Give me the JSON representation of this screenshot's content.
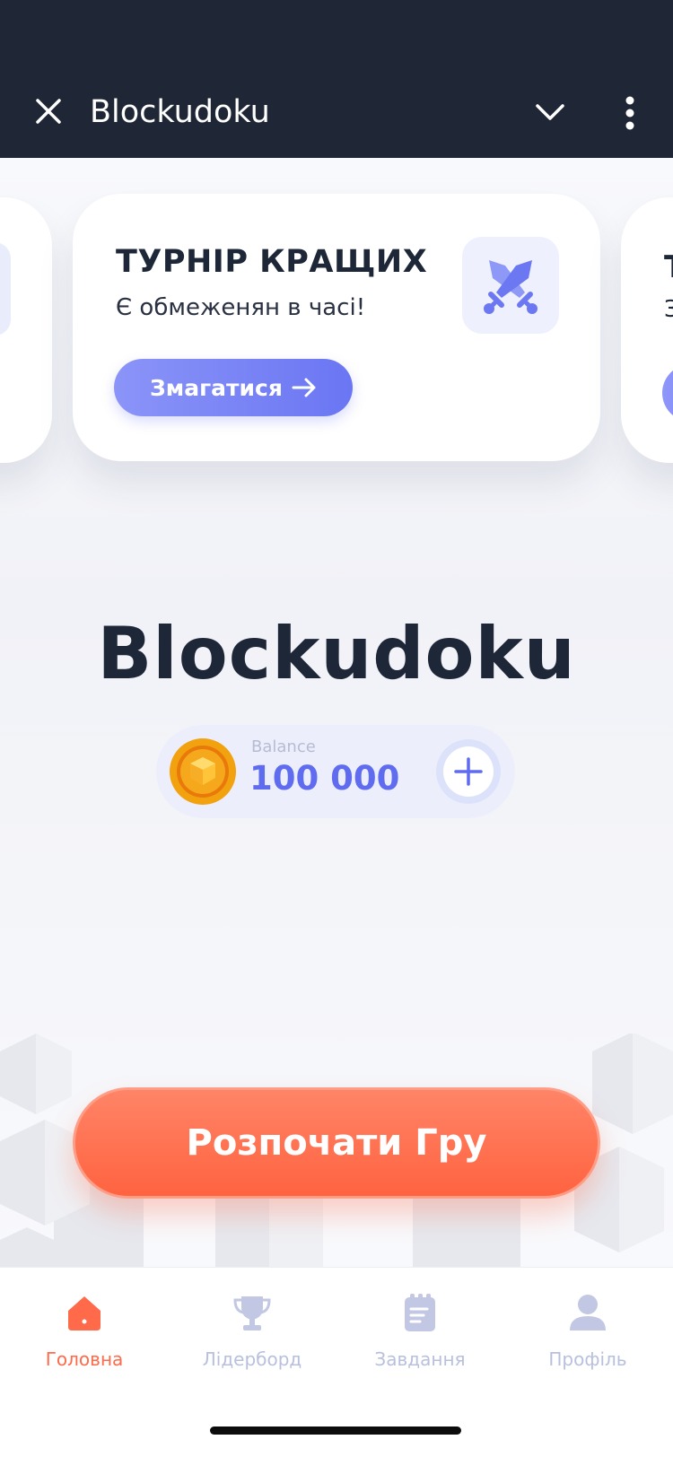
{
  "topbar": {
    "title": "Blockudoku",
    "close_icon": "close-icon",
    "dropdown_icon": "chevron-down-icon",
    "more_icon": "more-vertical-icon"
  },
  "tournament_card": {
    "title": "ТУРНІР КРАЩИХ",
    "subtitle": "Є обмеженян в часі!",
    "button_label": "Змагатися",
    "icon": "crossed-swords-icon"
  },
  "right_card_peek": {
    "title": "Т",
    "subtitle": "З"
  },
  "game": {
    "title": "Blockudoku"
  },
  "balance": {
    "label": "Balance",
    "value": "100 000",
    "coin_icon": "coin-icon",
    "add_icon": "plus-icon"
  },
  "start_button": {
    "label": "Розпочати Гру"
  },
  "tabs": [
    {
      "label": "Головна",
      "icon": "home-icon",
      "active": true
    },
    {
      "label": "Лідерборд",
      "icon": "trophy-icon",
      "active": false
    },
    {
      "label": "Завдання",
      "icon": "clipboard-icon",
      "active": false
    },
    {
      "label": "Профіль",
      "icon": "user-icon",
      "active": false
    }
  ],
  "colors": {
    "topbar_bg": "#1f2635",
    "accent_blue": "#6a76f3",
    "accent_orange": "#ff6a4a",
    "text_dark": "#1e2738",
    "inactive_tab": "#b9c0dd"
  }
}
